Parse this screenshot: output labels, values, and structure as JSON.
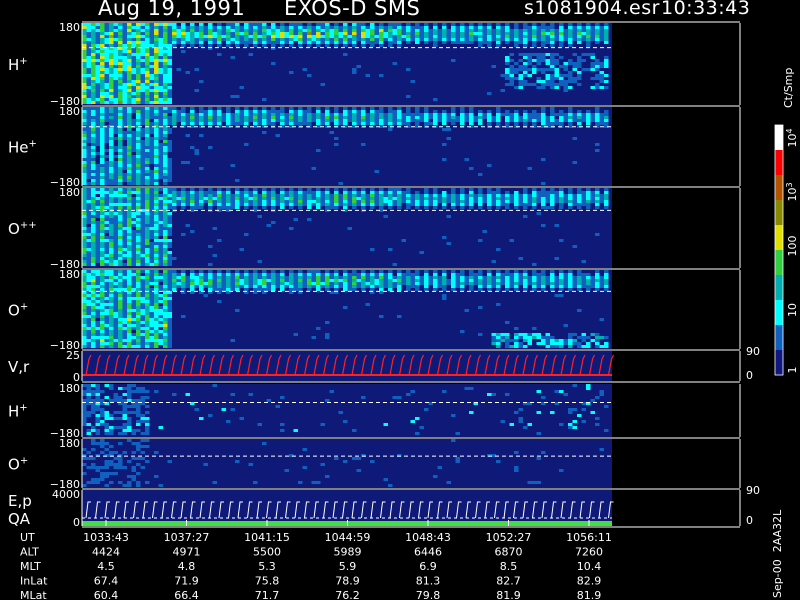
{
  "header": {
    "date": "Aug 19, 1991",
    "instrument": "EXOS-D SMS",
    "file": "s1081904.esr",
    "time": "10:33:43"
  },
  "colorbar": {
    "title": "Ct/Smp",
    "labels": [
      "10",
      "10",
      "100",
      "10",
      "1"
    ],
    "exponents": [
      "4",
      "3"
    ],
    "colors": [
      "#ffffff",
      "#ff0000",
      "#b35400",
      "#8a8a00",
      "#e0e000",
      "#30d040",
      "#00b0b0",
      "#00ffff",
      "#1060c0",
      "#101880"
    ]
  },
  "chart_data": {
    "type": "heatmap",
    "panels": [
      {
        "label": "H",
        "charge": "+",
        "ytick_top": "180",
        "ytick_bottom": "−180"
      },
      {
        "label": "He",
        "charge": "+",
        "ytick_top": "180",
        "ytick_bottom": "−180"
      },
      {
        "label": "O",
        "charge": "++",
        "ytick_top": "180",
        "ytick_bottom": "−180"
      },
      {
        "label": "O",
        "charge": "+",
        "ytick_top": "180",
        "ytick_bottom": "−180"
      },
      {
        "label": "V,r",
        "ytick_top": "25",
        "ytick_bottom": "0",
        "right_top": "90",
        "right_bottom": "0"
      },
      {
        "label": "H",
        "charge": "+",
        "ytick_top": "180",
        "ytick_bottom": "−180"
      },
      {
        "label": "O",
        "charge": "+",
        "ytick_top": "180",
        "ytick_bottom": "−180"
      },
      {
        "label": "E,p",
        "label2": "QA",
        "ytick_top": "4000",
        "ytick_bottom": "0",
        "right_top": "90",
        "right_bottom": "0"
      }
    ],
    "x_axis": {
      "rows": [
        {
          "name": "UT",
          "values": [
            "1033:43",
            "1037:27",
            "1041:15",
            "1044:59",
            "1048:43",
            "1052:27",
            "1056:11"
          ]
        },
        {
          "name": "ALT",
          "values": [
            "4424",
            "4971",
            "5500",
            "5989",
            "6446",
            "6870",
            "7260"
          ]
        },
        {
          "name": "MLT",
          "values": [
            "4.5",
            "4.8",
            "5.3",
            "5.9",
            "6.9",
            "8.5",
            "10.4"
          ]
        },
        {
          "name": "InLat",
          "values": [
            "67.4",
            "71.9",
            "75.8",
            "78.9",
            "81.3",
            "82.7",
            "82.9"
          ]
        },
        {
          "name": "MLat",
          "values": [
            "60.4",
            "66.4",
            "71.7",
            "76.2",
            "79.8",
            "81.9",
            "81.9"
          ]
        }
      ]
    },
    "version": "Sep-00  2AA32L"
  }
}
